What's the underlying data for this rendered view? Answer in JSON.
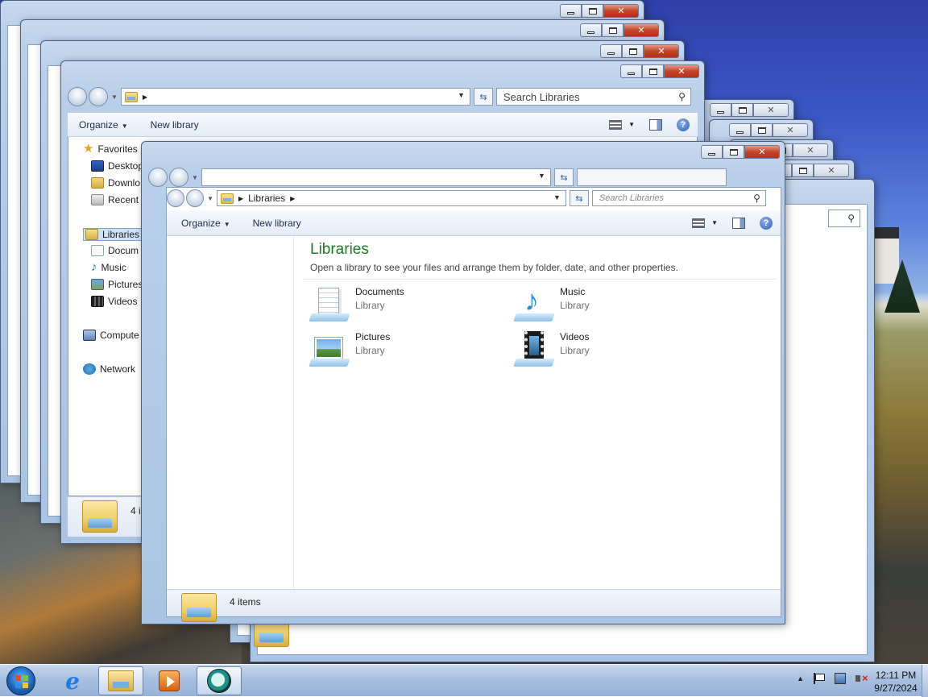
{
  "explorer": {
    "search_placeholder": "Search Libraries",
    "search_placeholder_small": "Search Libraries",
    "breadcrumb_root": "Libraries",
    "commands": {
      "organize": "Organize",
      "new_library": "New library"
    },
    "nav": {
      "favorites": "Favorites",
      "desktop": "Desktop",
      "downloads": "Downlo",
      "recent": "Recent P",
      "libraries": "Libraries",
      "documents": "Docum",
      "music": "Music",
      "pictures": "Pictures",
      "videos": "Videos",
      "computer": "Compute",
      "network": "Network"
    },
    "details_partial": "4 i",
    "content": {
      "title": "Libraries",
      "subtitle": "Open a library to see your files and arrange them by folder, date, and other properties.",
      "items": [
        {
          "name": "Documents",
          "type": "Library",
          "icon": "documents-library-icon"
        },
        {
          "name": "Music",
          "type": "Library",
          "icon": "music-library-icon"
        },
        {
          "name": "Pictures",
          "type": "Library",
          "icon": "pictures-library-icon"
        },
        {
          "name": "Videos",
          "type": "Library",
          "icon": "videos-library-icon"
        }
      ]
    },
    "status": "4 items"
  },
  "taskbar": {
    "time": "12:11 PM",
    "date": "9/27/2024",
    "tray_chevron": "▲"
  }
}
